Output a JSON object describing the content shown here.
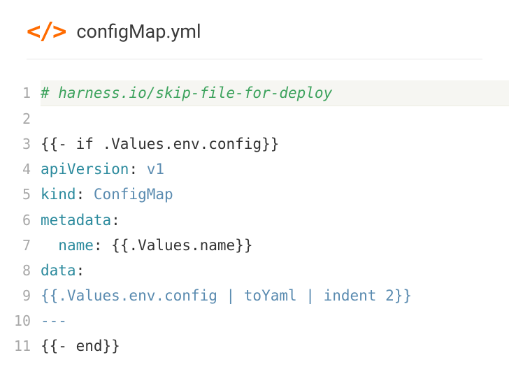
{
  "header": {
    "icon_glyph": "</>",
    "filename": "configMap.yml"
  },
  "code": {
    "lines": [
      {
        "n": 1,
        "highlight": true,
        "tokens": [
          {
            "t": "# harness.io/skip-file-for-deploy",
            "c": "tok-comment"
          }
        ]
      },
      {
        "n": 2,
        "tokens": [
          {
            "t": " ",
            "c": ""
          }
        ]
      },
      {
        "n": 3,
        "tokens": [
          {
            "t": "{{- ",
            "c": "tok-template"
          },
          {
            "t": "if",
            "c": "tok-template-kw"
          },
          {
            "t": " .Values.env.config}}",
            "c": "tok-template"
          }
        ]
      },
      {
        "n": 4,
        "tokens": [
          {
            "t": "apiVersion",
            "c": "tok-key"
          },
          {
            "t": ":",
            "c": "tok-colon"
          },
          {
            "t": " v1",
            "c": "tok-scalar"
          }
        ]
      },
      {
        "n": 5,
        "tokens": [
          {
            "t": "kind",
            "c": "tok-key"
          },
          {
            "t": ":",
            "c": "tok-colon"
          },
          {
            "t": " ConfigMap",
            "c": "tok-scalar"
          }
        ]
      },
      {
        "n": 6,
        "tokens": [
          {
            "t": "metadata",
            "c": "tok-key"
          },
          {
            "t": ":",
            "c": "tok-colon"
          }
        ]
      },
      {
        "n": 7,
        "indent": true,
        "tokens": [
          {
            "t": "  ",
            "c": ""
          },
          {
            "t": "name",
            "c": "tok-key"
          },
          {
            "t": ":",
            "c": "tok-colon"
          },
          {
            "t": " {{.Values.name}}",
            "c": "tok-scalar-plain"
          }
        ]
      },
      {
        "n": 8,
        "tokens": [
          {
            "t": "data",
            "c": "tok-key"
          },
          {
            "t": ":",
            "c": "tok-colon"
          }
        ]
      },
      {
        "n": 9,
        "tokens": [
          {
            "t": "{{.Values.env.config | toYaml | indent 2}}",
            "c": "tok-scalar"
          }
        ]
      },
      {
        "n": 10,
        "tokens": [
          {
            "t": "---",
            "c": "tok-sep"
          }
        ]
      },
      {
        "n": 11,
        "tokens": [
          {
            "t": "{{- ",
            "c": "tok-template"
          },
          {
            "t": "end",
            "c": "tok-template-kw"
          },
          {
            "t": "}}",
            "c": "tok-template"
          }
        ]
      }
    ]
  }
}
